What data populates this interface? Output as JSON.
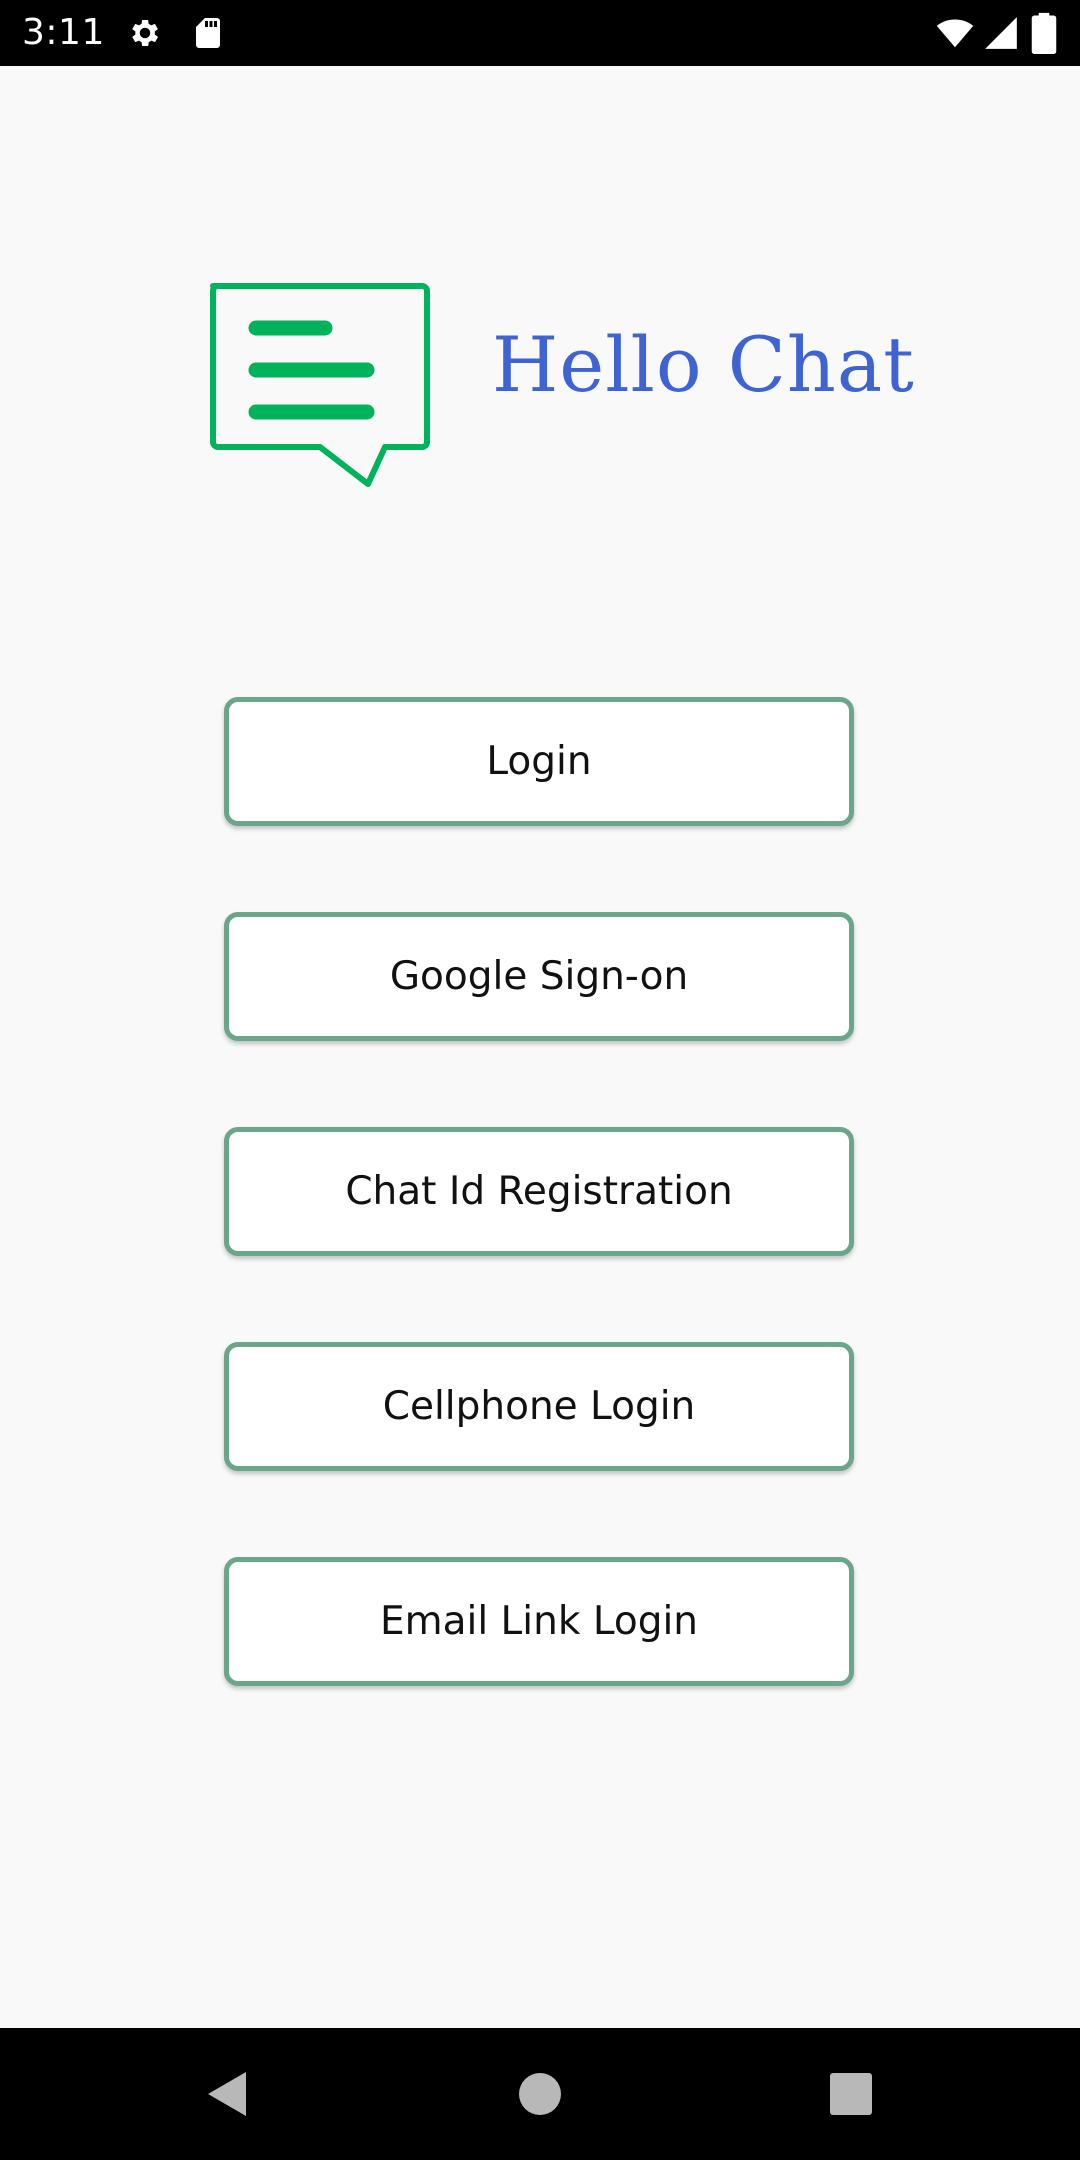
{
  "status_bar": {
    "time": "3:11",
    "icons": [
      "gear-icon",
      "sd-card-icon",
      "wifi-icon",
      "cell-signal-icon",
      "battery-icon"
    ]
  },
  "app": {
    "title": "Hello Chat",
    "logo_icon": "chat-bubble-icon",
    "brand_color": "#00b259",
    "title_color": "#3f63d3"
  },
  "buttons": [
    {
      "label": "Login"
    },
    {
      "label": "Google Sign-on"
    },
    {
      "label": "Chat Id Registration"
    },
    {
      "label": "Cellphone Login"
    },
    {
      "label": "Email Link Login"
    }
  ],
  "button_style": {
    "border_color": "#6ba58a"
  },
  "nav_bar": {
    "icons": [
      "back-icon",
      "home-icon",
      "recents-icon"
    ]
  }
}
